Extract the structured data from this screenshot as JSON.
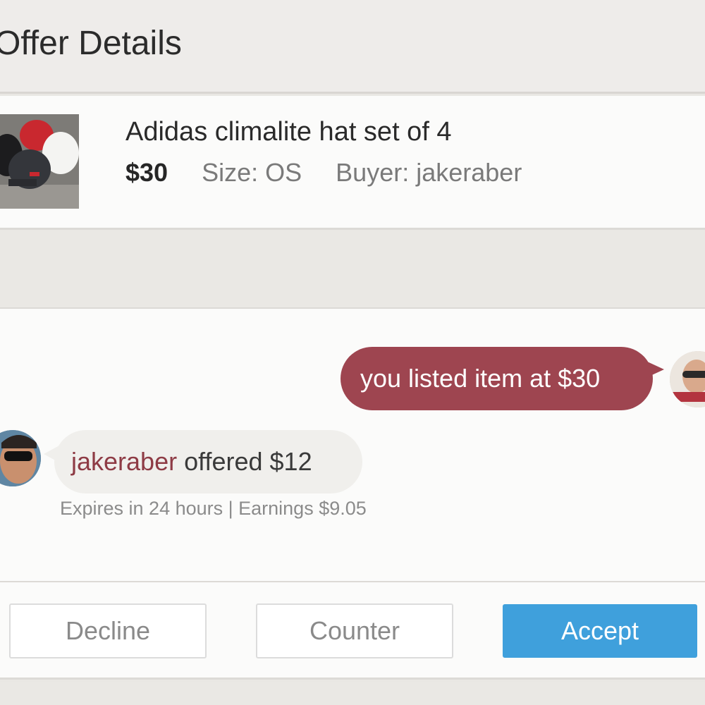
{
  "header": {
    "title": "Offer Details"
  },
  "item": {
    "title": "Adidas climalite hat set of 4",
    "price": "$30",
    "size": "Size: OS",
    "buyer": "Buyer: jakeraber",
    "thumbnail_icon": "hats-photo"
  },
  "chat": {
    "seller_message": "you listed item at $30",
    "seller_avatar_icon": "seller-avatar",
    "buyer_avatar_icon": "buyer-avatar",
    "offer_user": "jakeraber",
    "offer_text": "offered $12",
    "offer_info": "Expires in 24 hours | Earnings $9.05"
  },
  "actions": {
    "decline_label": "Decline",
    "counter_label": "Counter",
    "accept_label": "Accept"
  },
  "colors": {
    "accent_maroon": "#9e4550",
    "accept_blue": "#3fa0dc"
  }
}
